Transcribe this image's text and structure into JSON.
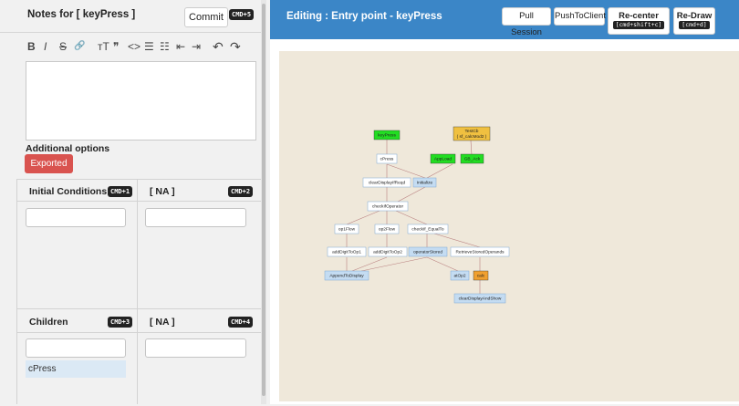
{
  "notes": {
    "title": "Notes for [ keyPress ]",
    "commit_label": "Commit",
    "commit_shortcut": "CMD+5",
    "toolbar": [
      "B",
      "I",
      "S",
      "🔗",
      "ᴛT",
      "❞",
      "<>",
      "☰",
      "☷",
      "⇤",
      "⇥",
      "↶",
      "↷"
    ],
    "additional_options": "Additional options",
    "exported_label": "Exported"
  },
  "initial_conditions": {
    "title": "Initial Conditions",
    "shortcut": "CMD+1"
  },
  "na_top": {
    "title": "[ NA ]",
    "shortcut": "CMD+2"
  },
  "children": {
    "title": "Children",
    "shortcut": "CMD+3",
    "items": [
      "cPress"
    ]
  },
  "na_bottom": {
    "title": "[ NA ]",
    "shortcut": "CMD+4"
  },
  "header": {
    "title": "Editing : Entry point - keyPress",
    "pull_session": "Pull Session",
    "push_to_client": "PushToClient",
    "recenter": "Re-center",
    "recenter_shortcut": "[cmd+shift+c]",
    "redraw": "Re-Draw",
    "redraw_shortcut": "[cmd+d]"
  },
  "graph": {
    "nodes": {
      "keyPress": "keyPress",
      "testCb": "TestCb",
      "testCbSub": "( sf_calcMod2 )",
      "cPress": "cPress",
      "appLoad": "AppLoad",
      "gbAck": "GB_Ack",
      "clearDisplay": "clearDisplayIfReqd",
      "initialize": "Initialize",
      "checkIfOperator": "checkIfOperator",
      "op1Flow": "op1Flow",
      "op2Flow": "op2Flow",
      "checkIfEqual": "checkIf_EqualTo",
      "addDigit1": "addDigitToOp1",
      "addDigit2": "addDigitToOp2",
      "operatorStored": "operatorStored",
      "retrieveStored": "RetrieveStoredOperands",
      "appendToDisplay": "AppendToDisplay",
      "atOp2": "atOp2",
      "calc": "calc",
      "clearAndShow": "clearDisplayAndShow"
    },
    "colors": {
      "green": "#22dd22",
      "gold": "#f0c040",
      "blue": "#c4dcf2",
      "orange": "#f0a030",
      "white": "#ffffff"
    }
  }
}
